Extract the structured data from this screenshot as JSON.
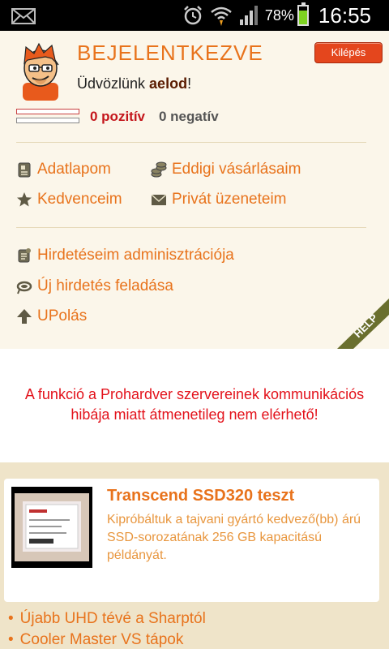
{
  "statusbar": {
    "battery_pct": "78%",
    "time": "16:55",
    "icons": [
      "mail-icon",
      "alarm-icon",
      "wifi-icon",
      "signal-icon",
      "battery-icon"
    ]
  },
  "header": {
    "title": "BEJELENTKEZVE",
    "logout_label": "Kilépés",
    "welcome_prefix": "Üdvözlünk ",
    "username": "aelod",
    "welcome_suffix": "!"
  },
  "rating": {
    "positive": "0 pozitív",
    "negative": "0 negatív"
  },
  "menu": {
    "adatlapom": "Adatlapom",
    "eddigi": "Eddigi vásárlásaim",
    "kedvenceim": "Kedvenceim",
    "privat": "Privát üzeneteim",
    "hirdeteseim": "Hirdetéseim adminisztrációja",
    "uj_hirdetes": "Új hirdetés feladása",
    "upolas": "UPolás"
  },
  "help_label": "HELP",
  "error": {
    "line1": "A funkció a Prohardver szervereinek kommunikációs",
    "line2": "hibája miatt átmenetileg nem elérhető!"
  },
  "article": {
    "title": "Transcend SSD320 teszt",
    "body": "Kipróbáltuk a tajvani gyártó kedvező(bb) árú SSD-sorozatának 256 GB kapacitású példányát."
  },
  "news_list": [
    "Újabb UHD tévé a Sharptól",
    "Cooler Master VS tápok"
  ],
  "colors": {
    "accent": "#e8731c",
    "error": "#e3121b",
    "logout_bg": "#e4461d"
  }
}
